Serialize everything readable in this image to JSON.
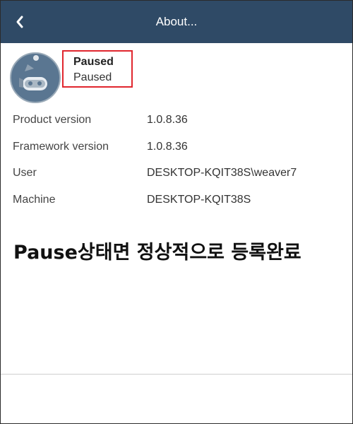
{
  "header": {
    "title": "About...",
    "back_icon": "back-arrow-icon",
    "background_color": "#2f4a66"
  },
  "status": {
    "title": "Paused",
    "subtitle": "Paused",
    "highlight_color": "#e0262e"
  },
  "avatar": {
    "icon": "robot-avatar-icon"
  },
  "info": [
    {
      "label": "Product version",
      "value": "1.0.8.36"
    },
    {
      "label": "Framework version",
      "value": "1.0.8.36"
    },
    {
      "label": "User",
      "value": "DESKTOP-KQIT38S\\weaver7"
    },
    {
      "label": "Machine",
      "value": "DESKTOP-KQIT38S"
    }
  ],
  "annotation": "Pause상태면 정상적으로 등록완료"
}
